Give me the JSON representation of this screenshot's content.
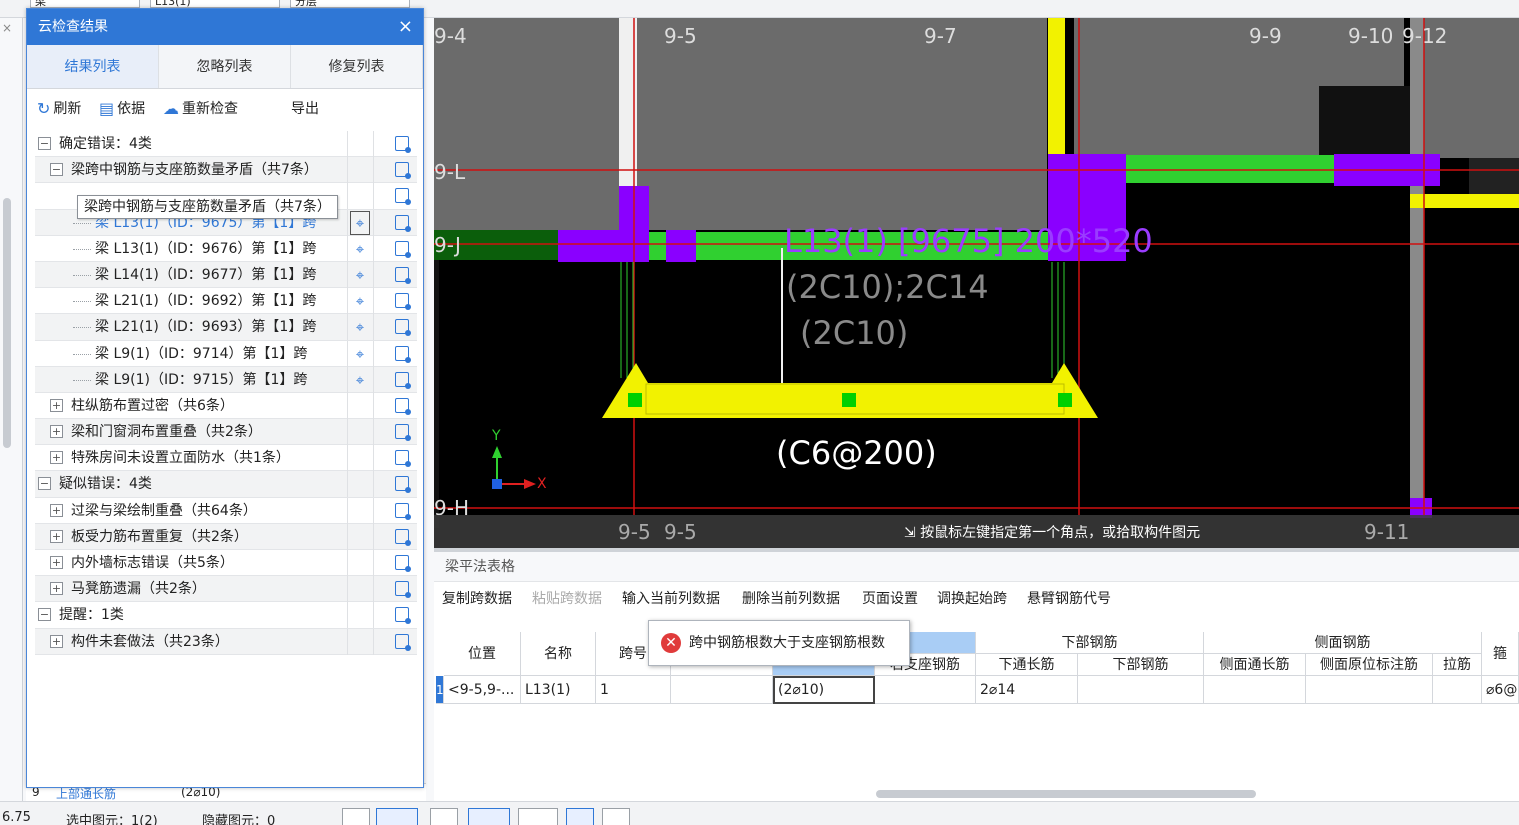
{
  "top": {
    "combo1": "梁",
    "combo2": "L13(1)",
    "combo3": "分层"
  },
  "dialog": {
    "title": "云检查结果",
    "tabs": [
      "结果列表",
      "忽略列表",
      "修复列表"
    ],
    "toolbar": {
      "refresh": "刷新",
      "basis": "依据",
      "recheck": "重新检查",
      "export": "导出"
    },
    "tooltip": "梁跨中钢筋与支座筋数量矛盾（共7条）",
    "tree": [
      {
        "label": "确定错误：4类",
        "level": 0,
        "box": "−"
      },
      {
        "label": "梁跨中钢筋与支座筋数量矛盾（共7条）",
        "level": 1,
        "box": "−"
      },
      {
        "label": "",
        "level": 2,
        "box": ""
      },
      {
        "label": "梁 L13(1)（ID：9675）第【1】跨",
        "level": 3,
        "link": true,
        "loc": true,
        "sel": true
      },
      {
        "label": "梁 L13(1)（ID：9676）第【1】跨",
        "level": 3,
        "loc": true
      },
      {
        "label": "梁 L14(1)（ID：9677）第【1】跨",
        "level": 3,
        "loc": true
      },
      {
        "label": "梁 L21(1)（ID：9692）第【1】跨",
        "level": 3,
        "loc": true
      },
      {
        "label": "梁 L21(1)（ID：9693）第【1】跨",
        "level": 3,
        "loc": true
      },
      {
        "label": "梁 L9(1)（ID：9714）第【1】跨",
        "level": 3,
        "loc": true
      },
      {
        "label": "梁 L9(1)（ID：9715）第【1】跨",
        "level": 3,
        "loc": true
      },
      {
        "label": "柱纵筋布置过密（共6条）",
        "level": 1,
        "box": "+"
      },
      {
        "label": "梁和门窗洞布置重叠（共2条）",
        "level": 1,
        "box": "+"
      },
      {
        "label": "特殊房间未设置立面防水（共1条）",
        "level": 1,
        "box": "+"
      },
      {
        "label": "疑似错误：4类",
        "level": 0,
        "box": "−"
      },
      {
        "label": "过梁与梁绘制重叠（共64条）",
        "level": 1,
        "box": "+"
      },
      {
        "label": "板受力筋布置重复（共2条）",
        "level": 1,
        "box": "+"
      },
      {
        "label": "内外墙标志错误（共5条）",
        "level": 1,
        "box": "+"
      },
      {
        "label": "马凳筋遗漏（共2条）",
        "level": 1,
        "box": "+"
      },
      {
        "label": "提醒：1类",
        "level": 0,
        "box": "−"
      },
      {
        "label": "构件未套做法（共23条）",
        "level": 1,
        "box": "+"
      }
    ],
    "below": {
      "num": "9",
      "name": "上部通长筋",
      "value": "(2⌀10)"
    }
  },
  "cad": {
    "axes": {
      "top": [
        "9-4",
        "9-5",
        "9-7",
        "9-9",
        "9-10",
        "9-12"
      ],
      "left": [
        "9-L",
        "9-J",
        "9-H"
      ],
      "bottom": [
        "9-5",
        "9-5",
        "9-11"
      ]
    },
    "beam_label": "L13(1) [9675] 200*520",
    "beam_top": "(2C10);2C14",
    "beam_bottom": "(2C10)",
    "stirrup": "(C6@200)",
    "ucs_x": "X",
    "ucs_y": "Y",
    "prompt": "按鼠标左键指定第一个角点，或拾取构件图元"
  },
  "table_panel": {
    "title": "梁平法表格",
    "toolbar": [
      "复制跨数据",
      "粘贴跨数据",
      "输入当前列数据",
      "删除当前列数据",
      "页面设置",
      "调换起始跨",
      "悬臂钢筋代号"
    ],
    "group_headers": {
      "bottom": "下部钢筋",
      "side": "侧面钢筋",
      "stirrup": "箍"
    },
    "headers": {
      "pos": "位置",
      "name": "名称",
      "span": "跨号",
      "right_support": "右支座钢筋",
      "bot_through": "下通长筋",
      "bot": "下部钢筋",
      "side_through": "侧面通长筋",
      "side_orig": "侧面原位标注筋",
      "tie": "拉筋"
    },
    "row": {
      "idx": "1",
      "pos": "<9-5,9-...",
      "name": "L13(1)",
      "span": "1",
      "top_through": "(2⌀10)",
      "bot_through": "2⌀14",
      "stirrup": "⌀6@"
    },
    "error_tip": "跨中钢筋根数大于支座钢筋根数"
  },
  "status": {
    "coord": "6.75",
    "selected": "选中图元：1(2)",
    "hidden": "隐藏图元：0"
  }
}
